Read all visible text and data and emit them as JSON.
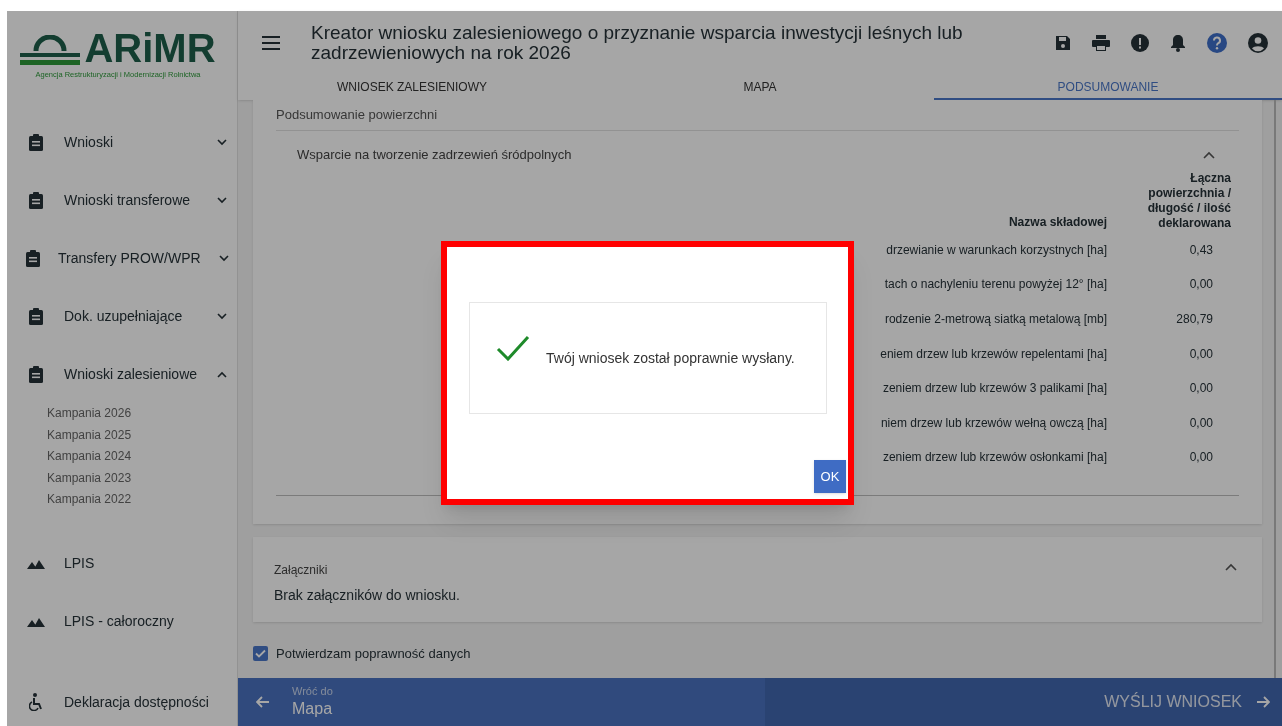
{
  "logo": {
    "name": "ARiMR",
    "subtitle": "Agencja Restrukturyzacji i Modernizacji Rolnictwa"
  },
  "sidebar": {
    "items": [
      {
        "label": "Wnioski",
        "kind": "group",
        "expanded": false
      },
      {
        "label": "Wnioski transferowe",
        "kind": "group",
        "expanded": false
      },
      {
        "label": "Transfery PROW/WPR",
        "kind": "group",
        "expanded": false
      },
      {
        "label": "Dok. uzupełniające",
        "kind": "group",
        "expanded": false
      },
      {
        "label": "Wnioski zalesieniowe",
        "kind": "group",
        "expanded": true,
        "children": [
          {
            "label": "Kampania 2026"
          },
          {
            "label": "Kampania 2025"
          },
          {
            "label": "Kampania 2024"
          },
          {
            "label": "Kampania 2023"
          },
          {
            "label": "Kampania 2022"
          }
        ]
      },
      {
        "label": "LPIS",
        "kind": "map"
      },
      {
        "label": "LPIS - całoroczny",
        "kind": "map"
      }
    ],
    "footer_item": {
      "label": "Deklaracja dostępności"
    }
  },
  "header": {
    "title": "Kreator wniosku zalesieniowego o przyznanie wsparcia inwestycji leśnych lub zadrzewieniowych na rok 2026"
  },
  "tabs": [
    {
      "label": "WNIOSEK ZALESIENIOWY",
      "selected": false
    },
    {
      "label": "MAPA",
      "selected": false
    },
    {
      "label": "PODSUMOWANIE",
      "selected": true
    }
  ],
  "summary": {
    "title": "Podsumowanie powierzchni",
    "section": {
      "title": "Wsparcie na tworzenie zadrzewień śródpolnych",
      "expanded": true,
      "columns": [
        "Nazwa składowej",
        "Łączna powierzchnia / długość / ilość deklarowana"
      ],
      "rows": [
        {
          "name": "drzewianie w warunkach korzystnych [ha]",
          "value": "0,43"
        },
        {
          "name": "tach o nachyleniu terenu powyżej 12° [ha]",
          "value": "0,00"
        },
        {
          "name": "rodzenie 2-metrową siatką metalową [mb]",
          "value": "280,79"
        },
        {
          "name": "eniem drzew lub krzewów repelentami [ha]",
          "value": "0,00"
        },
        {
          "name": "zeniem drzew lub krzewów 3 palikami [ha]",
          "value": "0,00"
        },
        {
          "name": "niem drzew lub krzewów wełną owczą [ha]",
          "value": "0,00"
        },
        {
          "name": "zeniem drzew lub krzewów osłonkami [ha]",
          "value": "0,00"
        }
      ]
    }
  },
  "attachments": {
    "title": "Załączniki",
    "expanded": true,
    "text": "Brak załączników do wniosku."
  },
  "confirm": {
    "label": "Potwierdzam poprawność danych",
    "checked": true
  },
  "footer": {
    "back_caption": "Wróć do",
    "back_target": "Mapa",
    "submit": "WYŚLIJ WNIOSEK"
  },
  "dialog": {
    "message": "Twój wniosek został poprawnie wysłany.",
    "button": "OK"
  }
}
